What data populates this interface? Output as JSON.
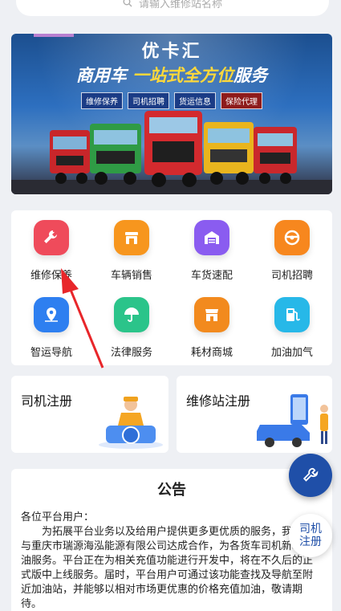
{
  "search": {
    "placeholder": "请输入维修站名称"
  },
  "banner": {
    "brand": "优卡汇",
    "tagline_a": "商用车",
    "tagline_b": "一站式全方位",
    "tagline_c": "服务",
    "chips": [
      "维修保养",
      "司机招聘",
      "货运信息",
      "保险代理"
    ]
  },
  "services": [
    {
      "label": "维修保养",
      "icon": "wrench-icon",
      "color": "#ef4b5b"
    },
    {
      "label": "车辆销售",
      "icon": "store-icon",
      "color": "#f7961e"
    },
    {
      "label": "车货速配",
      "icon": "garage-icon",
      "color": "#8a5cf0"
    },
    {
      "label": "司机招聘",
      "icon": "steering-wheel-icon",
      "color": "#f7871e"
    },
    {
      "label": "智运导航",
      "icon": "map-pin-icon",
      "color": "#2e7ff0"
    },
    {
      "label": "法律服务",
      "icon": "umbrella-icon",
      "color": "#2bc48a"
    },
    {
      "label": "耗材商城",
      "icon": "shop-icon",
      "color": "#f28a1e"
    },
    {
      "label": "加油加气",
      "icon": "fuel-icon",
      "color": "#27b8e8"
    }
  ],
  "register": {
    "driver": "司机注册",
    "station": "维修站注册"
  },
  "notice": {
    "title": "公告",
    "greeting": "各位平台用户：",
    "body": "为拓展平台业务以及给用户提供更多更优质的服务，我司已与重庆市瑞源海泓能源有限公司达成合作，为各货车司机新增供油服务。平台正在为相关充值功能进行开发中，将在不久后的正式版中上线服务。届时，平台用户可通过该功能查找及导航至附近加油站，并能够以相对市场更优惠的价格充值加油，敬请期待。"
  },
  "float_register": {
    "line1": "司机",
    "line2": "注册"
  }
}
